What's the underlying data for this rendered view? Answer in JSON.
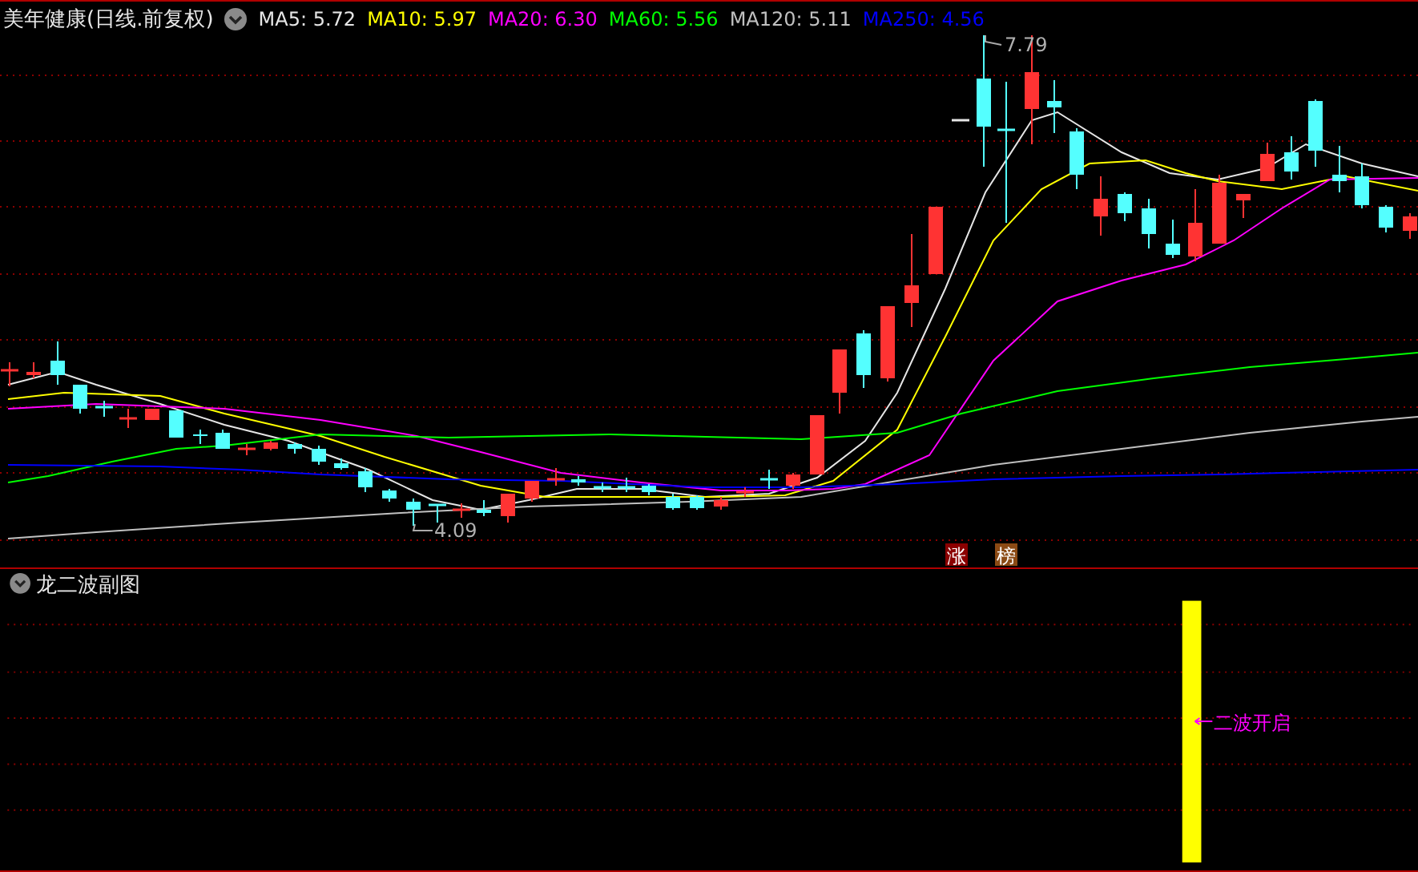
{
  "header": {
    "title": "美年健康(日线.前复权)",
    "indicators": [
      {
        "label": "MA5: 5.72",
        "color": "#e6e6e6"
      },
      {
        "label": "MA10: 5.97",
        "color": "#ffff00"
      },
      {
        "label": "MA20: 6.30",
        "color": "#ff00ff"
      },
      {
        "label": "MA60: 5.56",
        "color": "#00ff00"
      },
      {
        "label": "MA120: 5.11",
        "color": "#c0c0c0"
      },
      {
        "label": "MA250: 4.56",
        "color": "#0000ff"
      }
    ]
  },
  "price_chart": {
    "high_label": "7.79",
    "low_label": "4.09",
    "badges": [
      {
        "text": "涨",
        "color": "#8b0000"
      },
      {
        "text": "榜",
        "color": "#8b4a14"
      }
    ]
  },
  "sub_panel": {
    "title": "龙二波副图",
    "signal_label": "二波开启"
  }
}
